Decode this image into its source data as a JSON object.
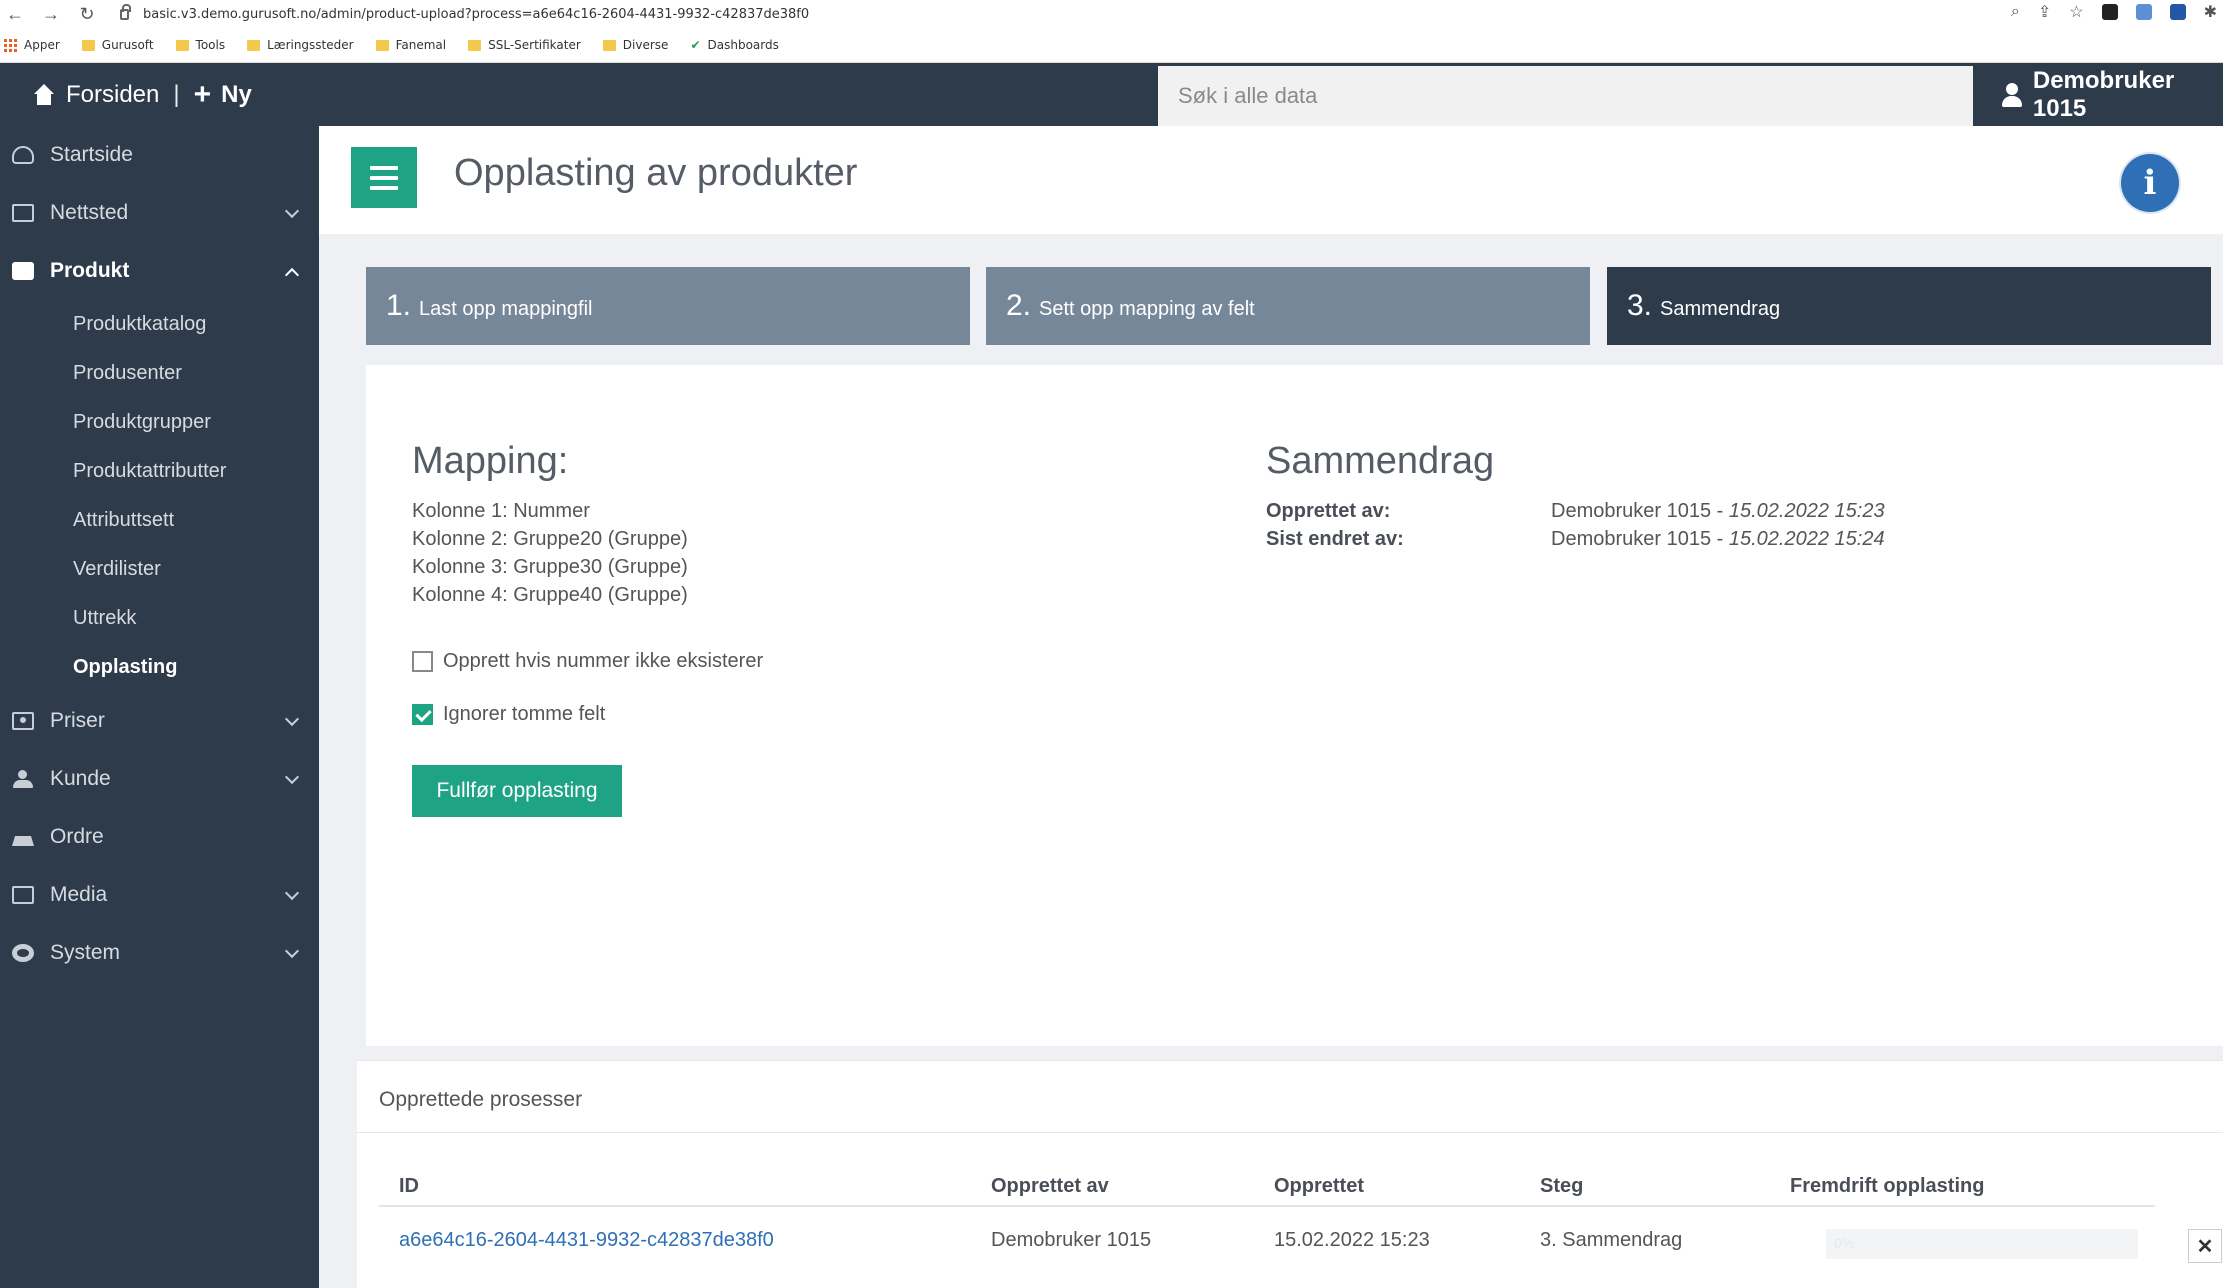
{
  "browser": {
    "url": "basic.v3.demo.gurusoft.no/admin/product-upload?process=a6e64c16-2604-4431-9932-c42837de38f0",
    "bookmarks": [
      "Apper",
      "Gurusoft",
      "Tools",
      "Læringssteder",
      "Fanemal",
      "SSL-Sertifikater",
      "Diverse",
      "Dashboards"
    ]
  },
  "topbar": {
    "home_label": "Forsiden",
    "separator": "|",
    "new_label": "Ny",
    "search_placeholder": "Søk i alle data",
    "user_name": "Demobruker 1015"
  },
  "sidebar": {
    "items": [
      {
        "label": "Startside",
        "icon": "dashboard-icon"
      },
      {
        "label": "Nettsted",
        "icon": "folder-icon"
      },
      {
        "label": "Produkt",
        "icon": "box-icon"
      },
      {
        "label": "Priser",
        "icon": "money-icon"
      },
      {
        "label": "Kunde",
        "icon": "users-icon"
      },
      {
        "label": "Ordre",
        "icon": "cart-icon"
      },
      {
        "label": "Media",
        "icon": "image-icon"
      },
      {
        "label": "System",
        "icon": "gear-icon"
      }
    ],
    "produkt_sub": [
      "Produktkatalog",
      "Produsenter",
      "Produktgrupper",
      "Produktattributter",
      "Attributtsett",
      "Verdilister",
      "Uttrekk",
      "Opplasting"
    ]
  },
  "page": {
    "title": "Opplasting av produkter",
    "info_glyph": "i"
  },
  "steps": [
    {
      "num": "1.",
      "label": "Last opp mappingfil",
      "active": false
    },
    {
      "num": "2.",
      "label": "Sett opp mapping av felt",
      "active": false
    },
    {
      "num": "3.",
      "label": "Sammendrag",
      "active": true
    }
  ],
  "mapping": {
    "heading": "Mapping:",
    "lines": [
      "Kolonne 1: Nummer",
      "Kolonne 2: Gruppe20 (Gruppe)",
      "Kolonne 3: Gruppe30 (Gruppe)",
      "Kolonne 4: Gruppe40 (Gruppe)"
    ]
  },
  "summary": {
    "heading": "Sammendrag",
    "created_key": "Opprettet av:",
    "created_user": "Demobruker 1015 - ",
    "created_date": "15.02.2022 15:23",
    "changed_key": "Sist endret av:",
    "changed_user": "Demobruker 1015 - ",
    "changed_date": "15.02.2022 15:24"
  },
  "options": {
    "create_if_missing": {
      "label": "Opprett hvis nummer ikke eksisterer",
      "checked": false
    },
    "ignore_empty": {
      "label": "Ignorer tomme felt",
      "checked": true
    }
  },
  "complete_button": "Fullfør opplasting",
  "processes": {
    "title": "Opprettede prosesser",
    "columns": [
      "ID",
      "Opprettet av",
      "Opprettet",
      "Steg",
      "Fremdrift opplasting"
    ],
    "rows": [
      {
        "id": "a6e64c16-2604-4431-9932-c42837de38f0",
        "created_by": "Demobruker 1015",
        "created": "15.02.2022 15:23",
        "step": "3. Sammendrag",
        "progress_text": "0%",
        "progress": 0
      }
    ],
    "delete_glyph": "✕"
  },
  "colors": {
    "accent": "#1fa385",
    "dark": "#2d3b4b",
    "step_inactive": "#77879a",
    "link": "#2e6fb6"
  }
}
